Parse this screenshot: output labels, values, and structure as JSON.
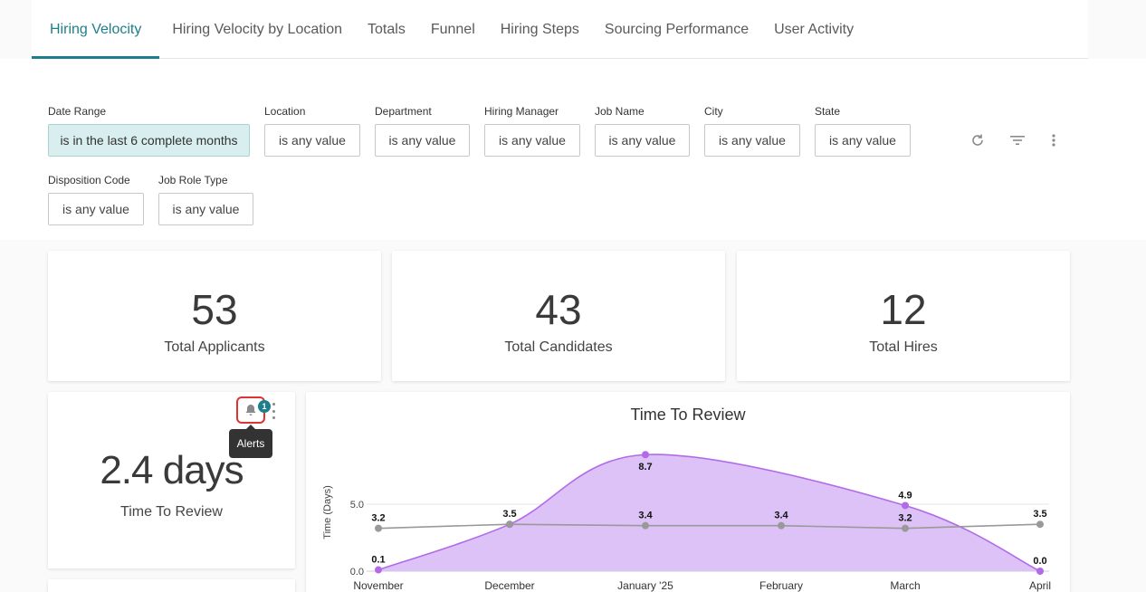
{
  "tabs": [
    {
      "label": "Hiring Velocity",
      "active": true
    },
    {
      "label": "Hiring Velocity by Location",
      "active": false
    },
    {
      "label": "Totals",
      "active": false
    },
    {
      "label": "Funnel",
      "active": false
    },
    {
      "label": "Hiring Steps",
      "active": false
    },
    {
      "label": "Sourcing Performance",
      "active": false
    },
    {
      "label": "User Activity",
      "active": false
    }
  ],
  "filters": [
    {
      "label": "Date Range",
      "value": "is in the last 6 complete months",
      "selected": true
    },
    {
      "label": "Location",
      "value": "is any value"
    },
    {
      "label": "Department",
      "value": "is any value"
    },
    {
      "label": "Hiring Manager",
      "value": "is any value"
    },
    {
      "label": "Job Name",
      "value": "is any value"
    },
    {
      "label": "City",
      "value": "is any value"
    },
    {
      "label": "State",
      "value": "is any value"
    },
    {
      "label": "Disposition Code",
      "value": "is any value"
    },
    {
      "label": "Job Role Type",
      "value": "is any value"
    }
  ],
  "toolbar": {
    "icons": [
      "refresh-icon",
      "filter-icon",
      "more-vert-icon"
    ]
  },
  "kpis": [
    {
      "value": "53",
      "label": "Total Applicants"
    },
    {
      "value": "43",
      "label": "Total Candidates"
    },
    {
      "value": "12",
      "label": "Total Hires"
    }
  ],
  "review_tile": {
    "value": "2.4 days",
    "label": "Time To Review",
    "alert_count": "1",
    "tooltip": "Alerts"
  },
  "colors": {
    "accent": "#1d7f8c",
    "series_area": "#b26ae9",
    "series_line": "#999999"
  },
  "chart_data": {
    "type": "area",
    "title": "Time To Review",
    "ylabel": "Time (Days)",
    "categories": [
      "November",
      "December",
      "January '25",
      "February",
      "March",
      "April"
    ],
    "yticks": [
      "0.0",
      "5.0"
    ],
    "ylim": [
      0,
      9
    ],
    "grid": true,
    "series": [
      {
        "values": [
          0.1,
          3.5,
          8.7,
          null,
          4.9,
          0.0
        ],
        "labels": [
          "0.1",
          "",
          "8.7",
          "",
          "4.9",
          "0.0"
        ],
        "color": "#b26ae9",
        "kind": "area"
      },
      {
        "values": [
          3.2,
          3.5,
          3.4,
          3.4,
          3.2,
          3.5
        ],
        "labels": [
          "3.2",
          "3.5",
          "3.4",
          "3.4",
          "3.2",
          "3.5"
        ],
        "color": "#999999",
        "kind": "line"
      }
    ]
  }
}
